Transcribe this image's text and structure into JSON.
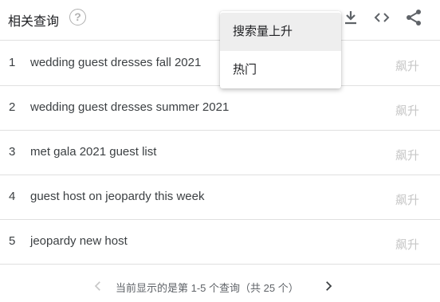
{
  "header": {
    "title": "相关查询",
    "help_glyph": "?",
    "icons": [
      "help-icon",
      "download-icon",
      "embed-icon",
      "share-icon"
    ]
  },
  "dropdown": {
    "items": [
      {
        "label": "搜索量上升",
        "selected": true
      },
      {
        "label": "热门",
        "selected": false
      }
    ]
  },
  "rows": [
    {
      "rank": "1",
      "query": "wedding guest dresses fall 2021",
      "value": "飙升"
    },
    {
      "rank": "2",
      "query": "wedding guest dresses summer 2021",
      "value": "飙升"
    },
    {
      "rank": "3",
      "query": "met gala 2021 guest list",
      "value": "飙升"
    },
    {
      "rank": "4",
      "query": "guest host on jeopardy this week",
      "value": "飙升"
    },
    {
      "rank": "5",
      "query": "jeopardy new host",
      "value": "飙升"
    }
  ],
  "footer": {
    "pagination_text": "当前显示的是第 1-5 个查询（共 25 个）"
  },
  "colors": {
    "divider": "#e0e0e0",
    "value_text": "#c7c7c7",
    "icon": "#5f6368",
    "menu_selected_bg": "#eeeeee"
  }
}
